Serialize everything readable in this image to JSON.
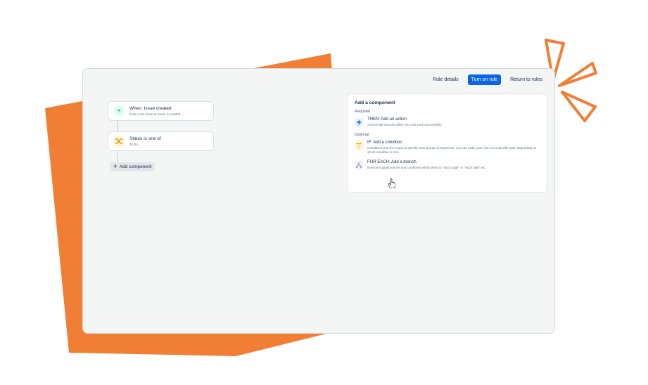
{
  "toolbar": {
    "rule_details": "Rule details",
    "turn_on_rule": "Turn on rule",
    "return_to_rules": "Return to rules"
  },
  "flow": {
    "trigger": {
      "title": "When: Issue created",
      "subtitle": "Rule is run when an issue is created",
      "icon": "plus-icon"
    },
    "condition": {
      "title": "Status is one of",
      "subtitle": "To Do",
      "icon": "shuffle-icon"
    },
    "add_component": "Add component"
  },
  "panel": {
    "title": "Add a component",
    "required_label": "Required",
    "optional_label": "Optional",
    "items": [
      {
        "title": "THEN: Add an action",
        "desc": "Actions will execute when your rule runs successfully.",
        "icon": "lightning-icon",
        "color": "#1d7afc"
      },
      {
        "title": "IF: Add a condition",
        "desc": "Conditions limit the scope to specific user groups or keywords. You can make your rule run a specific path, depending on which condition is met.",
        "icon": "filter-icon",
        "color": "#e2b203"
      },
      {
        "title": "FOR EACH: Add a branch",
        "desc": "Branches apply actions and conditions within them to \"each page\" or \"each task\" etc.",
        "icon": "branch-icon",
        "color": "#8f7ee7"
      }
    ]
  },
  "colors": {
    "brand_orange": "#f07f35",
    "primary_blue": "#0c66e4"
  }
}
